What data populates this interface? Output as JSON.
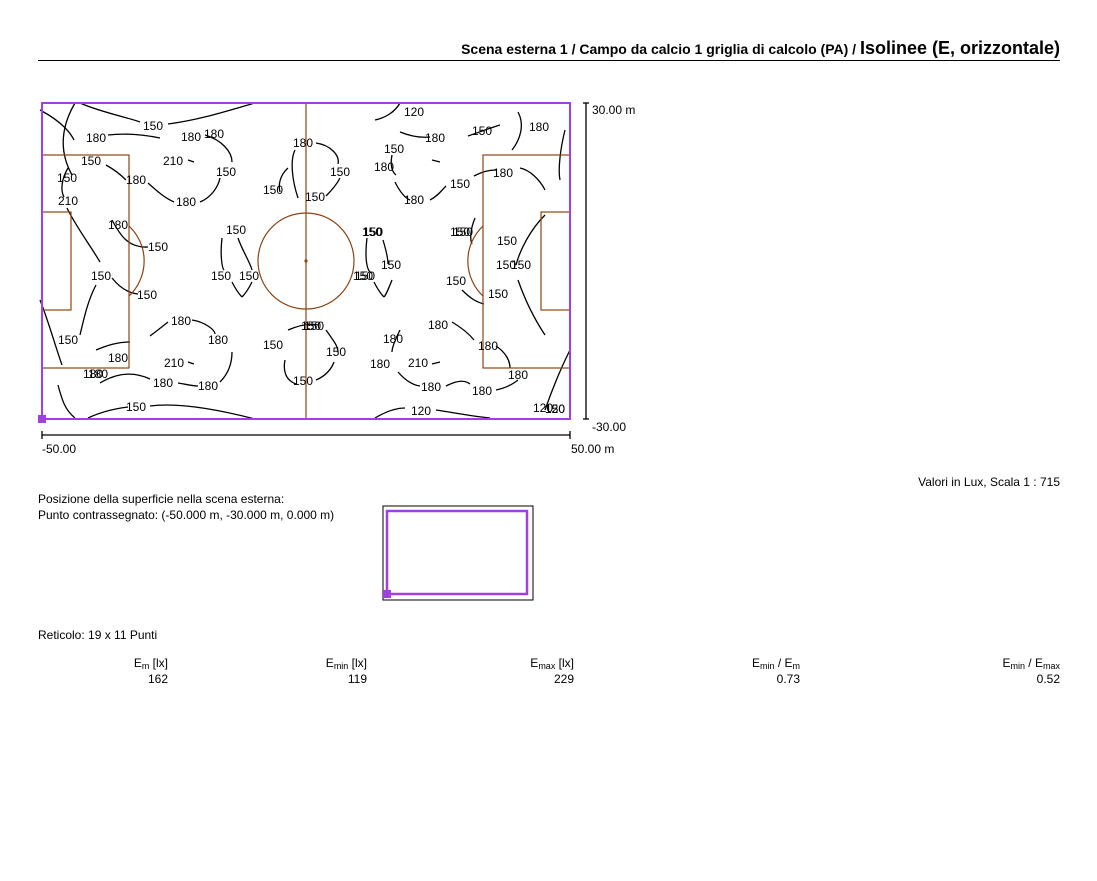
{
  "header": {
    "part1": "Scena esterna 1",
    "sep1": " / ",
    "part2": "Campo da calcio 1 griglia di calcolo (PA)",
    "sep2": " / ",
    "part3": "Isolinee (E, orizzontale)"
  },
  "axes": {
    "y_top": "30.00 m",
    "y_bottom": "-30.00",
    "x_left": "-50.00",
    "x_right": "50.00 m"
  },
  "contour_labels": [
    "120",
    "150",
    "180",
    "180",
    "150",
    "180",
    "180",
    "150",
    "180",
    "150",
    "120",
    "180",
    "210",
    "150",
    "180",
    "150",
    "180",
    "150",
    "180",
    "210",
    "180",
    "150",
    "180",
    "150",
    "150",
    "180",
    "150",
    "150",
    "150",
    "150",
    "150",
    "150",
    "150",
    "150",
    "150",
    "150",
    "150",
    "150",
    "150",
    "150",
    "180",
    "180",
    "180",
    "150",
    "150",
    "180",
    "180",
    "150",
    "210",
    "150",
    "180",
    "210",
    "180",
    "150",
    "180",
    "180",
    "180",
    "180",
    "150",
    "150",
    "180",
    "120",
    "120",
    "150",
    "150",
    "150",
    "150",
    "150",
    "180",
    "180"
  ],
  "scale_text": "Valori in Lux, Scala 1 : 715",
  "position": {
    "title": "Posizione della superficie nella scena esterna:",
    "point": "Punto contrassegnato: (-50.000 m, -30.000 m, 0.000 m)"
  },
  "grid": "Reticolo: 19 x 11 Punti",
  "stats": {
    "em": {
      "main": "E",
      "sub": "m",
      "unit": " [lx]",
      "value": "162"
    },
    "emin": {
      "main": "E",
      "sub": "min",
      "unit": " [lx]",
      "value": "119"
    },
    "emax": {
      "main": "E",
      "sub": "max",
      "unit": " [lx]",
      "value": "229"
    },
    "ratio1": {
      "main": "E",
      "sub": "min",
      "mid": " / E",
      "sub2": "m",
      "value": "0.73"
    },
    "ratio2": {
      "main": "E",
      "sub": "min",
      "mid": " / E",
      "sub2": "max",
      "value": "0.52"
    }
  },
  "colors": {
    "field": "#8b4513",
    "border": "#a040e0",
    "contour": "#000000"
  }
}
